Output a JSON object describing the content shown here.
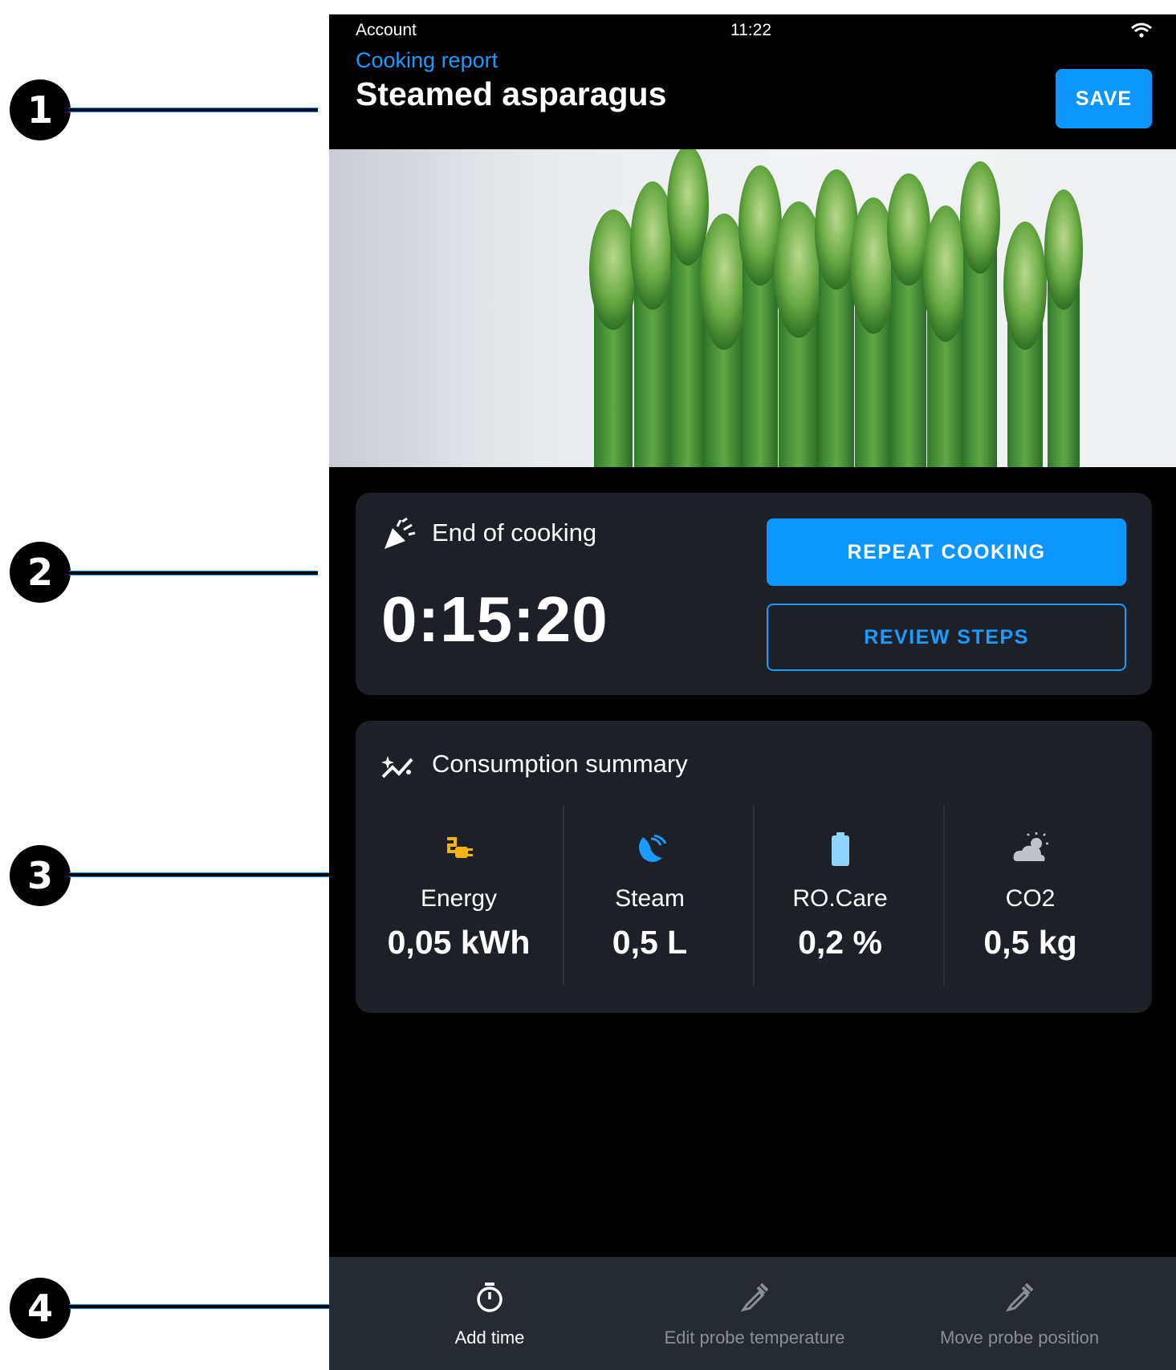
{
  "callouts": [
    "1",
    "2",
    "3",
    "4"
  ],
  "status_bar": {
    "account": "Account",
    "time": "11:22"
  },
  "header": {
    "subtitle": "Cooking report",
    "title": "Steamed asparagus",
    "save_label": "SAVE"
  },
  "end_of_cooking": {
    "title": "End of cooking",
    "duration": "0:15:20",
    "repeat_label": "REPEAT COOKING",
    "review_label": "REVIEW STEPS"
  },
  "consumption": {
    "title": "Consumption summary",
    "metrics": [
      {
        "label": "Energy",
        "value": "0,05 kWh",
        "icon": "energy-plug-icon",
        "color": "#f5b400"
      },
      {
        "label": "Steam",
        "value": "0,5 L",
        "icon": "steam-icon",
        "color": "#1a9bff"
      },
      {
        "label": "RO.Care",
        "value": "0,2 %",
        "icon": "battery-icon",
        "color": "#8fd3ff"
      },
      {
        "label": "CO2",
        "value": "0,5 kg",
        "icon": "cloud-sun-icon",
        "color": "#bfc3c9"
      }
    ]
  },
  "bottom_bar": {
    "items": [
      {
        "label": "Add time",
        "icon": "stopwatch-icon",
        "enabled": true
      },
      {
        "label": "Edit probe temperature",
        "icon": "probe-icon",
        "enabled": false
      },
      {
        "label": "Move probe position",
        "icon": "probe-icon",
        "enabled": false
      }
    ]
  },
  "colors": {
    "accent": "#0d96ff",
    "card": "#1d2127",
    "background": "#000000",
    "disabled_text": "#8a8f96"
  }
}
